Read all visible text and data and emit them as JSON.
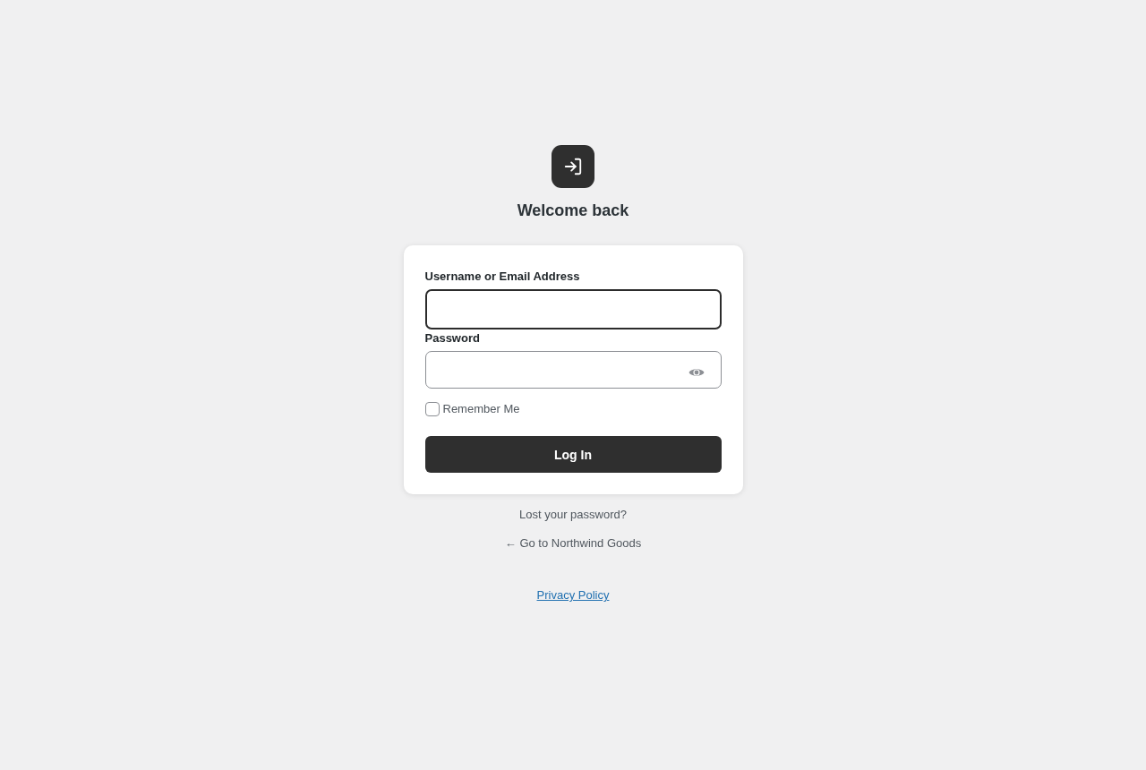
{
  "heading": "Welcome back",
  "form": {
    "fields": [
      {
        "kind": "text",
        "label": "Username or Email Address",
        "focused": true
      },
      {
        "kind": "password",
        "label": "Password",
        "focused": false
      }
    ],
    "remember": {
      "label": "Remember Me",
      "checked": false
    },
    "submit": "Log In"
  },
  "links": [
    "Lost your password?",
    "← Go to Northwind Goods"
  ],
  "privacy_link": "Privacy Policy"
}
